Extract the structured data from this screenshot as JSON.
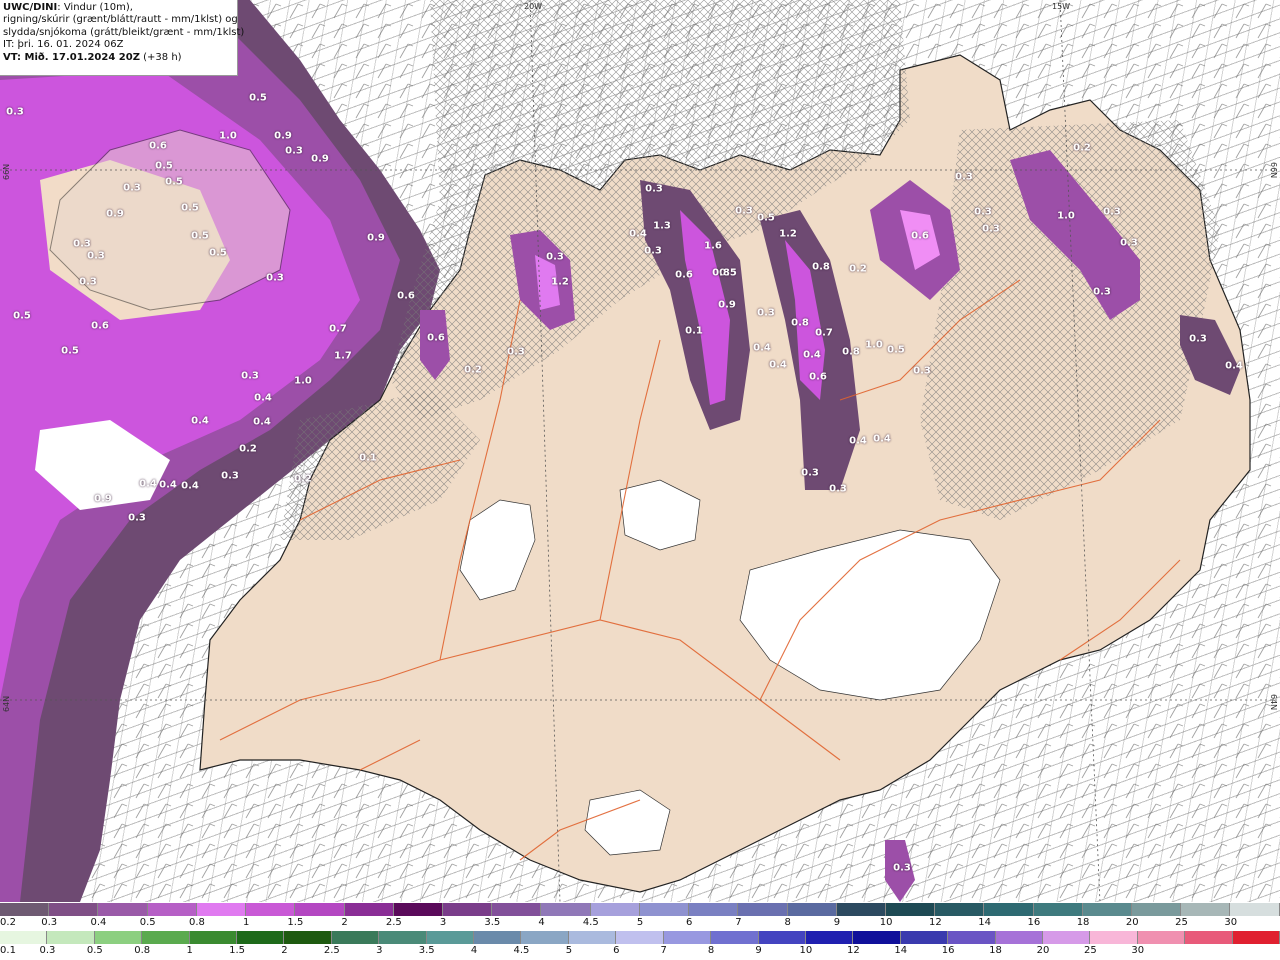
{
  "header": {
    "model": "UWC/DINI",
    "line1_rest": ": Vindur (10m),",
    "line2": "rigning/skúrir (grænt/blátt/rautt - mm/1klst) og",
    "line3": "slydda/snjókoma (grátt/bleikt/grænt - mm/1klst)",
    "line4": "IT: þri. 16. 01. 2024 06Z",
    "vt_prefix": "VT: ",
    "vt_value": "Mið. 17.01.2024 20Z",
    "vt_suffix": " (+38 h)"
  },
  "grid_labels": {
    "top_20w": "20W",
    "top_15w": "15W",
    "left_66n": "66N",
    "right_66n": "66N",
    "left_64n": "64N",
    "right_64n": "64N"
  },
  "colors": {
    "land": "#f0dcc8",
    "coast": "#222222",
    "roads": "#e0632f",
    "glacier": "#ffffff",
    "snow_light": "#6e4a72",
    "snow_mid": "#9c4fa8",
    "snow_strong": "#cc55dd",
    "snow_peak": "#f08ef5"
  },
  "precip_values": [
    "0.3",
    "0.5",
    "1.0",
    "0.9",
    "0.6",
    "0.5",
    "0.3",
    "0.9",
    "0.5",
    "0.5",
    "0.3",
    "0.9",
    "0.5",
    "0.3",
    "0.3",
    "0.5",
    "0.3",
    "0.3",
    "0.6",
    "0.5",
    "0.5",
    "0.9",
    "0.6",
    "0.7",
    "0.6",
    "1.7",
    "1.0",
    "0.3",
    "0.4",
    "0.4",
    "0.4",
    "0.2",
    "0.3",
    "0.2",
    "0.4",
    "0.4",
    "0.4",
    "0.9",
    "0.3",
    "0.1",
    "1.2",
    "0.3",
    "0.3",
    "0.4",
    "0.3",
    "1.3",
    "0.3",
    "0.5",
    "0.5",
    "1.6",
    "0.6",
    "0.8",
    "0.9",
    "1.2",
    "0.8",
    "0.3",
    "0.4",
    "0.4",
    "0.4",
    "0.8",
    "0.7",
    "0.6",
    "0.8",
    "1.0",
    "0.5",
    "0.4",
    "0.4",
    "0.3",
    "0.3",
    "0.3",
    "0.2",
    "0.3",
    "0.3",
    "0.6",
    "0.3",
    "0.3",
    "0.3",
    "1.0",
    "0.2",
    "0.3",
    "0.3",
    "0.4",
    "0.3",
    "0.2",
    "0.3",
    "0.1"
  ],
  "legend_snow": {
    "colors": [
      "#6e5a72",
      "#7f4f86",
      "#9a5aa8",
      "#b65fc6",
      "#e07af0",
      "#c959d6",
      "#b447c2",
      "#8a2d96",
      "#5a0a5a",
      "#7a3d8a",
      "#82509a",
      "#9078b8",
      "#a6a0dc",
      "#8f92d0",
      "#7a80c2",
      "#6a70b0",
      "#5a6aa0",
      "#2c4a60",
      "#1e4a54",
      "#285a64",
      "#2e6a72",
      "#3e7a7e",
      "#5a8a8e",
      "#7a9a9c",
      "#a7b7b7",
      "#d6dede"
    ],
    "ticks": [
      "0.2",
      "0.3",
      "0.4",
      "0.5",
      "0.8",
      "1",
      "1.5",
      "2",
      "2.5",
      "3",
      "3.5",
      "4",
      "4.5",
      "5",
      "6",
      "7",
      "8",
      "9",
      "10",
      "12",
      "14",
      "16",
      "18",
      "20",
      "25",
      "30"
    ]
  },
  "legend_rain": {
    "colors": [
      "#e6f6e0",
      "#c4e8bc",
      "#8ccf80",
      "#5aaa4e",
      "#3a8a30",
      "#1e6a1a",
      "#1e5a10",
      "#3a7a5a",
      "#4a8a78",
      "#5a9a98",
      "#6a8aaa",
      "#8aa6c4",
      "#aabade",
      "#c0c0ee",
      "#9898e0",
      "#7070d0",
      "#4444c0",
      "#2020b0",
      "#10109a",
      "#3a3aae",
      "#6a54c4",
      "#a672d8",
      "#d69ae8",
      "#f8b6d8",
      "#f090b0",
      "#e85a7a",
      "#e02030"
    ],
    "ticks": [
      "0.1",
      "0.3",
      "0.5",
      "0.8",
      "1",
      "1.5",
      "2",
      "2.5",
      "3",
      "3.5",
      "4",
      "4.5",
      "5",
      "6",
      "7",
      "8",
      "9",
      "10",
      "12",
      "14",
      "16",
      "18",
      "20",
      "25",
      "30"
    ]
  }
}
